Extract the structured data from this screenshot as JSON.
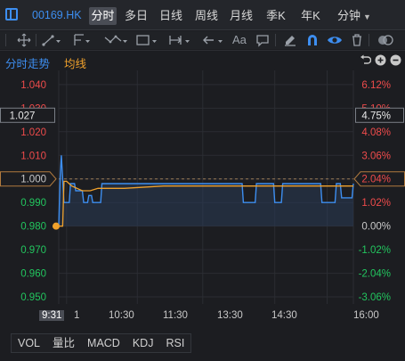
{
  "header": {
    "symbol": "00169.HK",
    "tabs": [
      {
        "label": "分时",
        "active": true
      },
      {
        "label": "多日",
        "active": false
      },
      {
        "label": "日线",
        "active": false
      },
      {
        "label": "周线",
        "active": false
      },
      {
        "label": "月线",
        "active": false
      },
      {
        "label": "季K",
        "active": false
      },
      {
        "label": "年K",
        "active": false
      },
      {
        "label": "分钟",
        "active": false,
        "dropdown": true
      }
    ]
  },
  "toolbar": {
    "tools": [
      "crosshair-icon",
      "line-segment-icon",
      "channel-icon",
      "wave-icon",
      "range-icon",
      "arrow-left-icon",
      "text-icon",
      "comment-icon",
      "eraser-icon",
      "magnet-icon",
      "eye-icon",
      "trash-icon",
      "toggle-icon"
    ],
    "text_tool": "Aa"
  },
  "chart_header": {
    "mode": "分时走势",
    "avg_label": "均线"
  },
  "chart_data": {
    "type": "line",
    "prev_close": 1.0,
    "y_left": [
      "1.040",
      "1.030",
      "1.020",
      "1.010",
      "1.000",
      "0.990",
      "0.980",
      "0.970",
      "0.960",
      "0.950"
    ],
    "y_left_values": [
      1.04,
      1.03,
      1.02,
      1.01,
      1.0,
      0.99,
      0.98,
      0.97,
      0.96,
      0.95
    ],
    "y_right": [
      "6.12%",
      "5.10%",
      "4.08%",
      "3.06%",
      "2.04%",
      "1.02%",
      "0.00%",
      "-1.02%",
      "-2.04%",
      "-3.06%"
    ],
    "y_right_values": [
      6.12,
      5.1,
      4.08,
      3.06,
      2.04,
      1.02,
      0.0,
      -1.02,
      -2.04,
      -3.06
    ],
    "ylim": [
      0.947,
      1.046
    ],
    "cursor_price_left": "1.027",
    "cursor_price_right": "4.75%",
    "highlight_left": "1.000",
    "highlight_right": "2.04%",
    "x_labels": [
      "9:31",
      "1",
      "10:30",
      "11:30",
      "13:30",
      "14:30",
      "16:00"
    ],
    "series": [
      {
        "name": "分时",
        "color": "#3d8ef0",
        "points": [
          [
            0,
            0.98
          ],
          [
            1,
            1.0
          ],
          [
            2,
            1.01
          ],
          [
            3,
            1.0
          ],
          [
            4,
            0.99
          ],
          [
            5,
            0.99
          ],
          [
            8,
            0.99
          ],
          [
            9,
            0.998
          ],
          [
            10,
            0.998
          ],
          [
            12,
            0.998
          ],
          [
            13,
            0.995
          ],
          [
            18,
            0.995
          ],
          [
            19,
            0.99
          ],
          [
            22,
            0.99
          ],
          [
            23,
            0.993
          ],
          [
            25,
            0.993
          ],
          [
            26,
            0.99
          ],
          [
            32,
            0.99
          ],
          [
            33,
            0.998
          ],
          [
            60,
            0.998
          ],
          [
            61,
            0.998
          ],
          [
            85,
            0.998
          ],
          [
            86,
            0.998
          ],
          [
            140,
            0.998
          ],
          [
            141,
            0.99
          ],
          [
            150,
            0.99
          ],
          [
            151,
            0.998
          ],
          [
            164,
            0.998
          ],
          [
            165,
            0.99
          ],
          [
            170,
            0.99
          ],
          [
            171,
            0.998
          ],
          [
            200,
            0.998
          ],
          [
            201,
            0.99
          ],
          [
            211,
            0.99
          ],
          [
            212,
            0.998
          ],
          [
            215,
            0.998
          ],
          [
            216,
            0.992
          ],
          [
            224,
            0.992
          ],
          [
            225,
            0.998
          ]
        ]
      },
      {
        "name": "均线",
        "color": "#f0a12c",
        "points": [
          [
            0,
            0.98
          ],
          [
            3,
            0.98
          ],
          [
            4,
            0.999
          ],
          [
            6,
            0.999
          ],
          [
            10,
            0.997
          ],
          [
            18,
            0.995
          ],
          [
            24,
            0.995
          ],
          [
            30,
            0.996
          ],
          [
            40,
            0.996
          ],
          [
            50,
            0.996
          ],
          [
            80,
            0.997
          ],
          [
            120,
            0.997
          ],
          [
            140,
            0.997
          ],
          [
            160,
            0.997
          ],
          [
            190,
            0.997
          ],
          [
            225,
            0.997
          ]
        ]
      }
    ],
    "x_max": 225,
    "grid": true
  },
  "indicators": [
    "VOL",
    "量比",
    "MACD",
    "KDJ",
    "RSI"
  ],
  "colors": {
    "up": "#ef4b4b",
    "down": "#22c55e",
    "accent": "#3d8ef0",
    "avg": "#f0a12c"
  }
}
